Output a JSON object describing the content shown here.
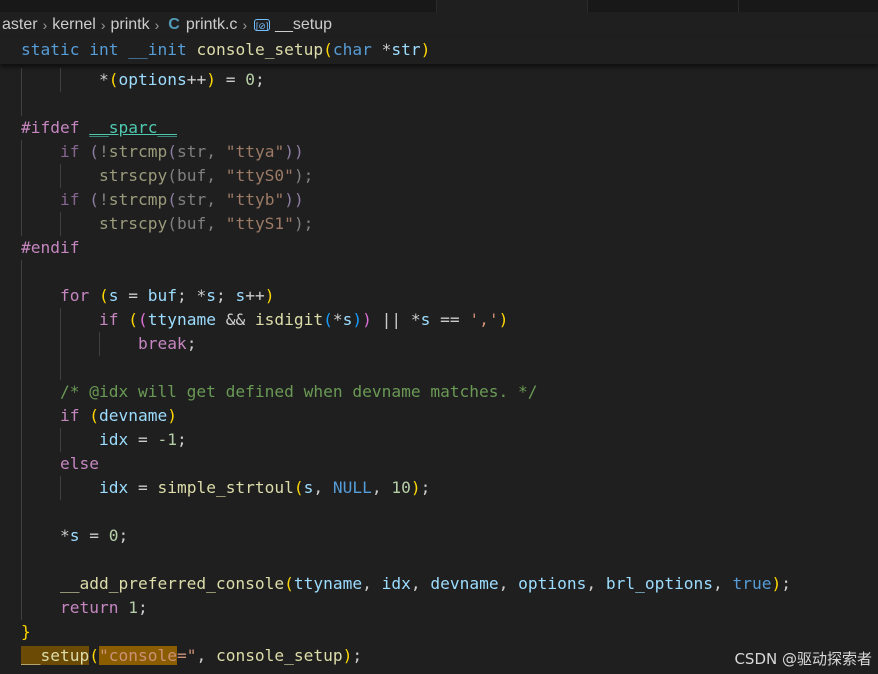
{
  "breadcrumb": {
    "segments": [
      "aster",
      "kernel",
      "printk",
      "printk.c",
      "__setup"
    ],
    "file_icon": "C",
    "symbol_icon": "[⊘]"
  },
  "sticky": {
    "static": "static",
    "int": "int",
    "init": "__init",
    "fn": "console_setup",
    "char": "char",
    "star": "*",
    "param": "str"
  },
  "code": {
    "l_options": "options",
    "l_zero": "0",
    "ifdef": "#ifdef",
    "sparc": "__sparc__",
    "if": "if",
    "strcmp": "strcmp",
    "strscpy": "strscpy",
    "str": "str",
    "buf": "buf",
    "ttya": "\"ttya\"",
    "ttyS0": "\"ttyS0\"",
    "ttyb": "\"ttyb\"",
    "ttyS1": "\"ttyS1\"",
    "endif": "#endif",
    "for": "for",
    "s": "s",
    "ttyname": "ttyname",
    "isdigit": "isdigit",
    "comma": "','",
    "break": "break",
    "comment": "/* @idx will get defined when devname matches. */",
    "devname": "devname",
    "idx": "idx",
    "minus_one": "-1",
    "else": "else",
    "strtoul": "simple_strtoul",
    "null": "NULL",
    "ten": "10",
    "zero": "0",
    "add_pref": "__add_preferred_console",
    "options": "options",
    "brl_options": "brl_options",
    "true": "true",
    "return": "return",
    "one": "1",
    "setup": "__setup",
    "console_str_a": "\"console",
    "console_str_b": "=\"",
    "console_setup": "console_setup"
  },
  "watermark": "CSDN @驱动探索者",
  "colors": {
    "background": "#1f1f1f",
    "keyword": "#569cd6",
    "control": "#c586c0",
    "function": "#dcdcaa",
    "variable": "#9cdcfe",
    "string": "#ce9178",
    "number": "#b5cea8",
    "comment": "#6a9955",
    "search_highlight": "#8a5d00"
  }
}
